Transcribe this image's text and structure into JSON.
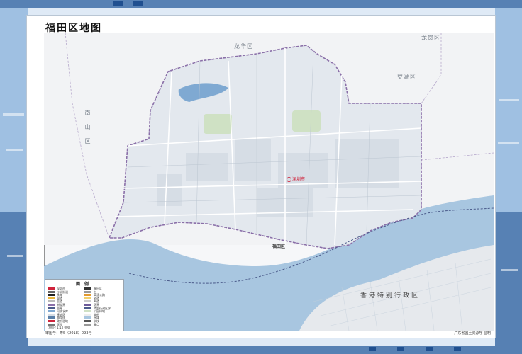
{
  "title": "福田区地图",
  "place_labels": {
    "north": "龙华区",
    "east": "罗湖区",
    "far_east": "龙岗区",
    "west_vertical": "南山区",
    "hong_kong": "香港特别行政区",
    "city": "深圳市",
    "district_seat": "福田区"
  },
  "legend": {
    "title": "图例",
    "items": [
      "深圳市",
      "福田区",
      "沙头街道",
      "村",
      "铁路",
      "高速公路",
      "国道",
      "省道",
      "县道",
      "乡道",
      "街道界",
      "区界",
      "市界",
      "特别行政区界",
      "河流水库",
      "公园绿地",
      "建筑区",
      "其他",
      "海岸线",
      "水域",
      "政府驻地",
      "学校",
      "医院",
      "景点"
    ],
    "scale": "比例尺 1:10 000"
  },
  "footer": {
    "left": "审图号：粤S（2018）093号",
    "right": "广东省国土资源厅  监制"
  },
  "colors": {
    "water": "#a8c6e0",
    "land": "#eef1f5",
    "boundary": "#8a6fa8",
    "city_red": "#d0243c"
  }
}
